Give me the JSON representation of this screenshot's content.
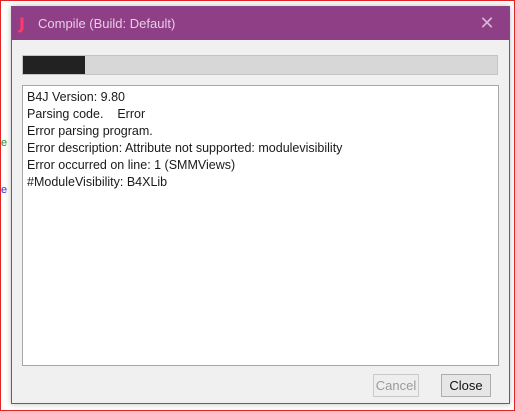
{
  "background": {
    "fragment_green": "e",
    "fragment_blue": "e"
  },
  "dialog": {
    "app_logo": "J",
    "title": "Compile (Build: Default)",
    "close_glyph": "✕",
    "progress_fraction": 0.13,
    "log_lines": [
      "B4J Version: 9.80",
      "Parsing code.    Error",
      "Error parsing program.",
      "Error description: Attribute not supported: modulevisibility",
      "Error occurred on line: 1 (SMMViews)",
      "#ModuleVisibility: B4XLib"
    ],
    "buttons": {
      "cancel": "Cancel",
      "close": "Close"
    }
  },
  "colors": {
    "titlebar": "#8e3f86",
    "frame_outline": "#e22424",
    "progress_fill": "#222222"
  }
}
